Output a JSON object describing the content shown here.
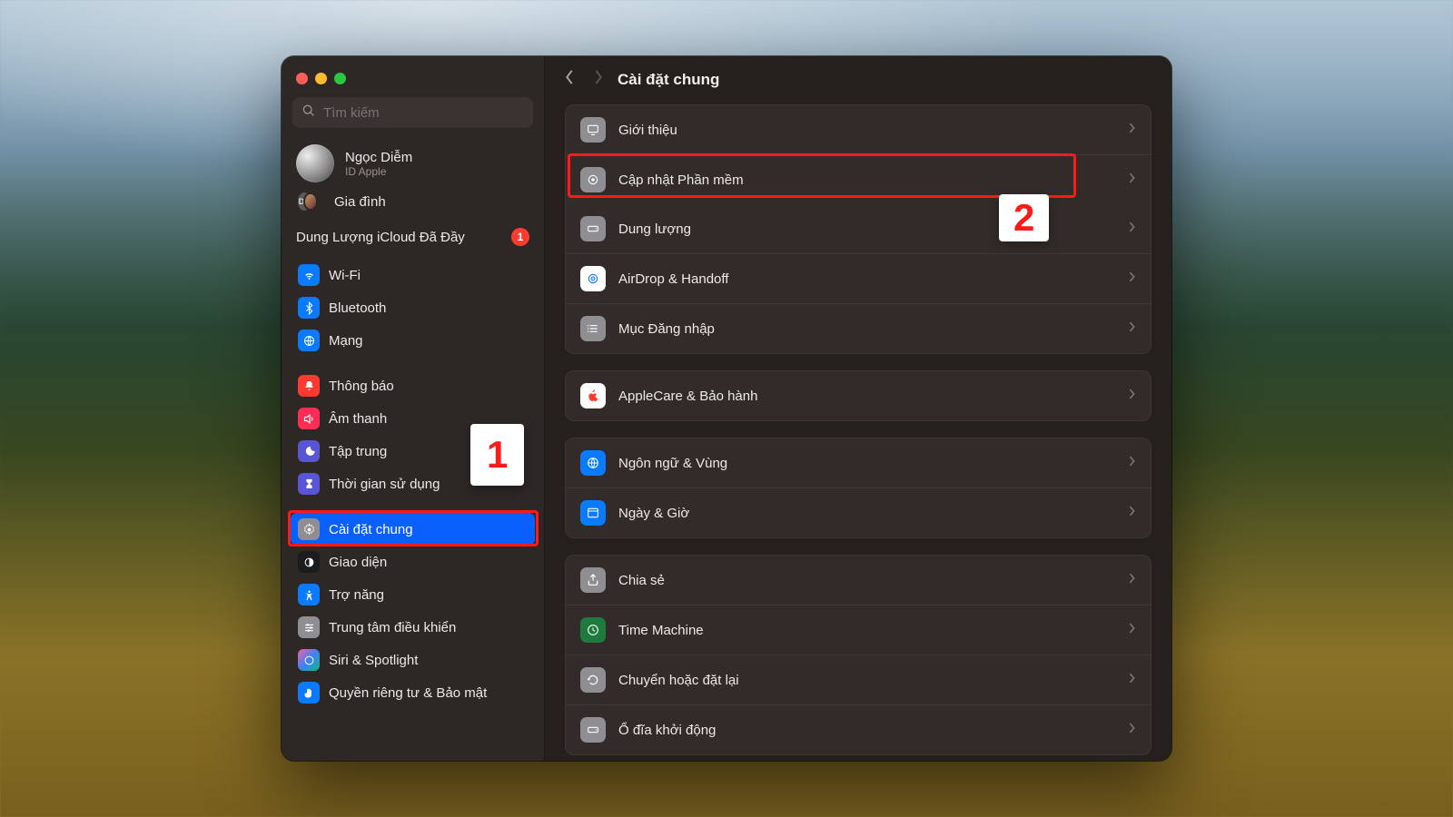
{
  "search": {
    "placeholder": "Tìm kiếm"
  },
  "account": {
    "name": "Ngọc Diễm",
    "sub": "ID Apple"
  },
  "family": {
    "label": "Gia đình",
    "initials": "DC"
  },
  "storage": {
    "text": "Dung Lượng iCloud Đã Đầy",
    "badge": "1"
  },
  "title": "Cài đặt chung",
  "annotations": {
    "one": "1",
    "two": "2"
  },
  "sidebar": {
    "g1": [
      {
        "label": "Wi-Fi",
        "color": "#0a7aff"
      },
      {
        "label": "Bluetooth",
        "color": "#0a7aff"
      },
      {
        "label": "Mạng",
        "color": "#0a7aff"
      }
    ],
    "g2": [
      {
        "label": "Thông báo",
        "color": "#ff3b30"
      },
      {
        "label": "Âm thanh",
        "color": "#ff2d55"
      },
      {
        "label": "Tập trung",
        "color": "#5856d6"
      },
      {
        "label": "Thời gian sử dụng",
        "color": "#5856d6"
      }
    ],
    "g3": [
      {
        "label": "Cài đặt chung",
        "color": "#8e8e93"
      },
      {
        "label": "Giao diện",
        "color": "#1c1c1e"
      },
      {
        "label": "Trợ năng",
        "color": "#0a7aff"
      },
      {
        "label": "Trung tâm điều khiển",
        "color": "#8e8e93"
      },
      {
        "label": "Siri & Spotlight",
        "color": "#000"
      },
      {
        "label": "Quyền riêng tư & Bảo mật",
        "color": "#0a7aff"
      }
    ]
  },
  "main": {
    "p1": [
      {
        "label": "Giới thiệu",
        "color": "#8e8e93"
      },
      {
        "label": "Cập nhật Phần mềm",
        "color": "#8e8e93"
      },
      {
        "label": "Dung lượng",
        "color": "#8e8e93"
      },
      {
        "label": "AirDrop & Handoff",
        "color": "#ffffff"
      },
      {
        "label": "Mục Đăng nhập",
        "color": "#8e8e93"
      }
    ],
    "p2": [
      {
        "label": "AppleCare & Bảo hành",
        "color": "#ffffff"
      }
    ],
    "p3": [
      {
        "label": "Ngôn ngữ & Vùng",
        "color": "#0a7aff"
      },
      {
        "label": "Ngày & Giờ",
        "color": "#0a7aff"
      }
    ],
    "p4": [
      {
        "label": "Chia sẻ",
        "color": "#8e8e93"
      },
      {
        "label": "Time Machine",
        "color": "#34c759"
      },
      {
        "label": "Chuyển hoặc đặt lại",
        "color": "#8e8e93"
      },
      {
        "label": "Ổ đĩa khởi động",
        "color": "#8e8e93"
      }
    ]
  }
}
